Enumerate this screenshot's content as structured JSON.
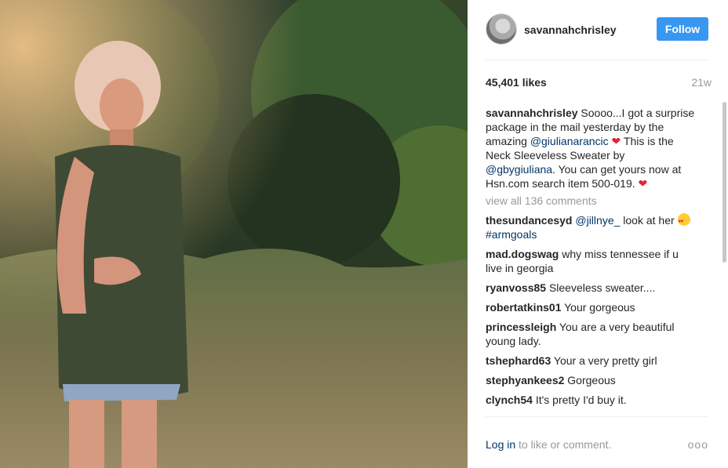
{
  "post": {
    "username": "savannahchrisley",
    "follow_label": "Follow",
    "likes": "45,401 likes",
    "age": "21w"
  },
  "caption": {
    "username": "savannahchrisley",
    "part1": " Soooo...I got a surprise package in the mail yesterday by the amazing ",
    "mention1": "@giulianarancic",
    "part2": " This is the Neck Sleeveless Sweater by ",
    "mention2": "@gbygiuliana",
    "part3": ". You can get yours now at Hsn.com search item 500-019. "
  },
  "view_all": "view all 136 comments",
  "comments": [
    {
      "user": "thesundancesyd",
      "mention": "@jillnye_",
      "text": " look at her ",
      "hashtag": "#armgoals"
    },
    {
      "user": "mad.dogswag",
      "text": " why miss tennessee if u live in georgia"
    },
    {
      "user": "ryanvoss85",
      "text": " Sleeveless sweater...."
    },
    {
      "user": "robertatkins01",
      "text": " Your gorgeous"
    },
    {
      "user": "princessleigh",
      "text": " You are a very beautiful young lady."
    },
    {
      "user": "tshephard63",
      "text": " Your a very pretty girl"
    },
    {
      "user": "stephyankees2",
      "text": " Gorgeous"
    },
    {
      "user": "clynch54",
      "text": " It's pretty I'd buy it."
    }
  ],
  "footer": {
    "login": "Log in",
    "rest": " to like or comment.",
    "more": "ooo"
  },
  "icons": {
    "heart": "heart-emoji",
    "heart_eyes": "heart-eyes-emoji"
  }
}
